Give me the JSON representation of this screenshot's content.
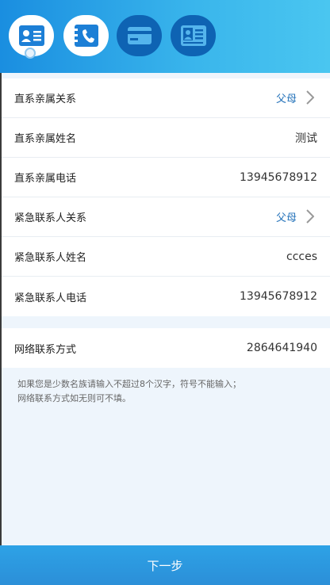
{
  "steps": [
    {
      "name": "id-card",
      "state": "active"
    },
    {
      "name": "phone-book",
      "state": "active"
    },
    {
      "name": "bank-card",
      "state": "inactive"
    },
    {
      "name": "work-badge",
      "state": "inactive"
    }
  ],
  "form": {
    "relatives": [
      {
        "label": "直系亲属关系",
        "value": "父母",
        "type": "select"
      },
      {
        "label": "直系亲属姓名",
        "value": "测试",
        "type": "text"
      },
      {
        "label": "直系亲属电话",
        "value": "13945678912",
        "type": "text"
      }
    ],
    "emergency": [
      {
        "label": "紧急联系人关系",
        "value": "父母",
        "type": "select"
      },
      {
        "label": "紧急联系人姓名",
        "value": "ccces",
        "type": "text"
      },
      {
        "label": "紧急联系人电话",
        "value": "13945678912",
        "type": "text"
      }
    ],
    "network": {
      "label": "网络联系方式",
      "value": "2864641940"
    }
  },
  "hint": {
    "line1": "如果您是少数名族请输入不超过8个汉字，符号不能输入；",
    "line2": "网络联系方式如无则可不填。"
  },
  "footer": {
    "next_label": "下一步"
  },
  "colors": {
    "header_start": "#1a8ee0",
    "header_end": "#4ac6f0",
    "link": "#1f6fb8",
    "footer": "#2c8fd8"
  }
}
